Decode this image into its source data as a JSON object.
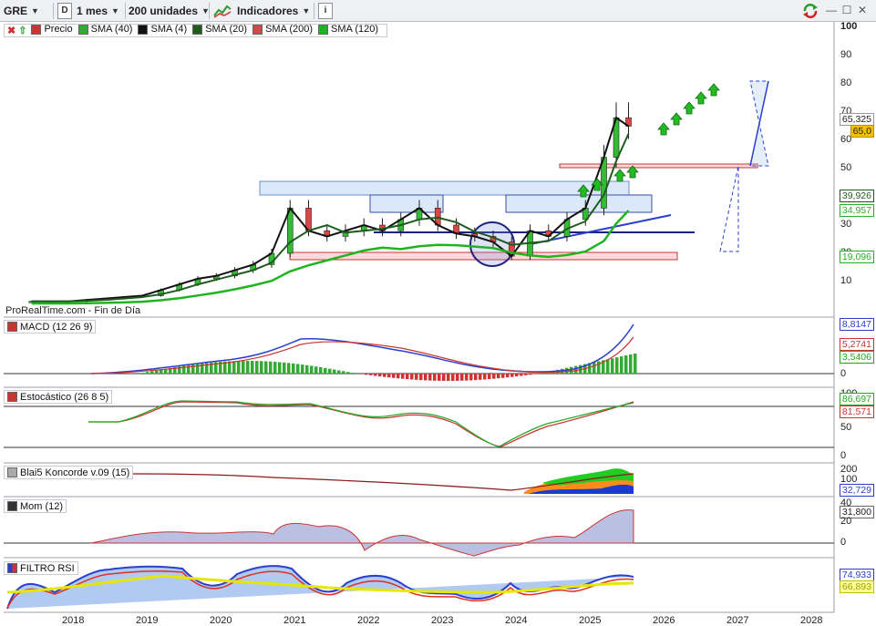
{
  "toolbar": {
    "symbol": "GRE",
    "d_button": "D",
    "period": "1 mes",
    "units": "200 unidades",
    "indicators": "Indicadores",
    "info_button": "i"
  },
  "credit": "ProRealTime.com - Fin de Día",
  "legend": [
    {
      "label": "Precio",
      "color": "#cc3333"
    },
    {
      "label": "SMA (40)",
      "color": "#33aa33"
    },
    {
      "label": "SMA (4)",
      "color": "#111111"
    },
    {
      "label": "SMA (20)",
      "color": "#1e5c1e"
    },
    {
      "label": "SMA (200)",
      "color": "#d04a4a"
    },
    {
      "label": "SMA (120)",
      "color": "#1fb41f"
    }
  ],
  "panels": {
    "macd": {
      "title": "MACD (12 26 9)",
      "values": [
        "8,8147",
        "5,2741",
        "3,5406"
      ],
      "zero": "0"
    },
    "stoch": {
      "title": "Estocástico (26 8 5)",
      "values": [
        "86,697",
        "81,571"
      ],
      "ticks": [
        "100",
        "50",
        "0"
      ]
    },
    "koncorde": {
      "title": "Blai5 Koncorde v.09 (15)",
      "values": [
        "32,729"
      ],
      "ticks": [
        "200",
        "100",
        "0"
      ]
    },
    "mom": {
      "title": "Mom (12)",
      "values": [
        "31,800"
      ],
      "ticks": [
        "40",
        "20",
        "0"
      ]
    },
    "rsi": {
      "title": "FILTRO RSI",
      "values": [
        "74,933",
        "66,893"
      ]
    }
  },
  "price_axis": {
    "ticks": [
      "100",
      "90",
      "80",
      "70",
      "60",
      "50",
      "40",
      "30",
      "20",
      "10"
    ],
    "badges": [
      {
        "label": "65,325",
        "color": "#222222"
      },
      {
        "label": "65,0",
        "color": "#c09000"
      },
      {
        "label": "39,926",
        "color": "#1e5c1e"
      },
      {
        "label": "34,957",
        "color": "#33aa33"
      },
      {
        "label": "19,096",
        "color": "#1fb41f"
      }
    ]
  },
  "x_axis": [
    "2018",
    "2019",
    "2020",
    "2021",
    "2022",
    "2023",
    "2024",
    "2025",
    "2026",
    "2027",
    "2028"
  ],
  "chart_data": {
    "type": "candlestick",
    "interval": "1 mes",
    "x": [
      "2017-06",
      "2017-09",
      "2017-12",
      "2018-03",
      "2018-06",
      "2018-09",
      "2018-12",
      "2019-03",
      "2019-06",
      "2019-09",
      "2019-12",
      "2020-03",
      "2020-06",
      "2020-09",
      "2020-12",
      "2021-03",
      "2021-06",
      "2021-09",
      "2021-12",
      "2022-03",
      "2022-06",
      "2022-09",
      "2022-12",
      "2023-03",
      "2023-06",
      "2023-09",
      "2023-12",
      "2024-03",
      "2024-06",
      "2024-09",
      "2024-12",
      "2025-03",
      "2025-05",
      "2025-07"
    ],
    "close": [
      3,
      3,
      3,
      3.5,
      4,
      4.5,
      5,
      7,
      9,
      11,
      12,
      14,
      16,
      20,
      36,
      28,
      26,
      28,
      30,
      28,
      32,
      36,
      30,
      27,
      26,
      24,
      19,
      28,
      26,
      32,
      36,
      54,
      68,
      65
    ],
    "sma4_last": 65.325,
    "sma20_last": 39.926,
    "sma40_last": 34.957,
    "sma120_last": 19.096,
    "ylim": [
      0,
      100
    ],
    "price_badge": 65.0
  }
}
